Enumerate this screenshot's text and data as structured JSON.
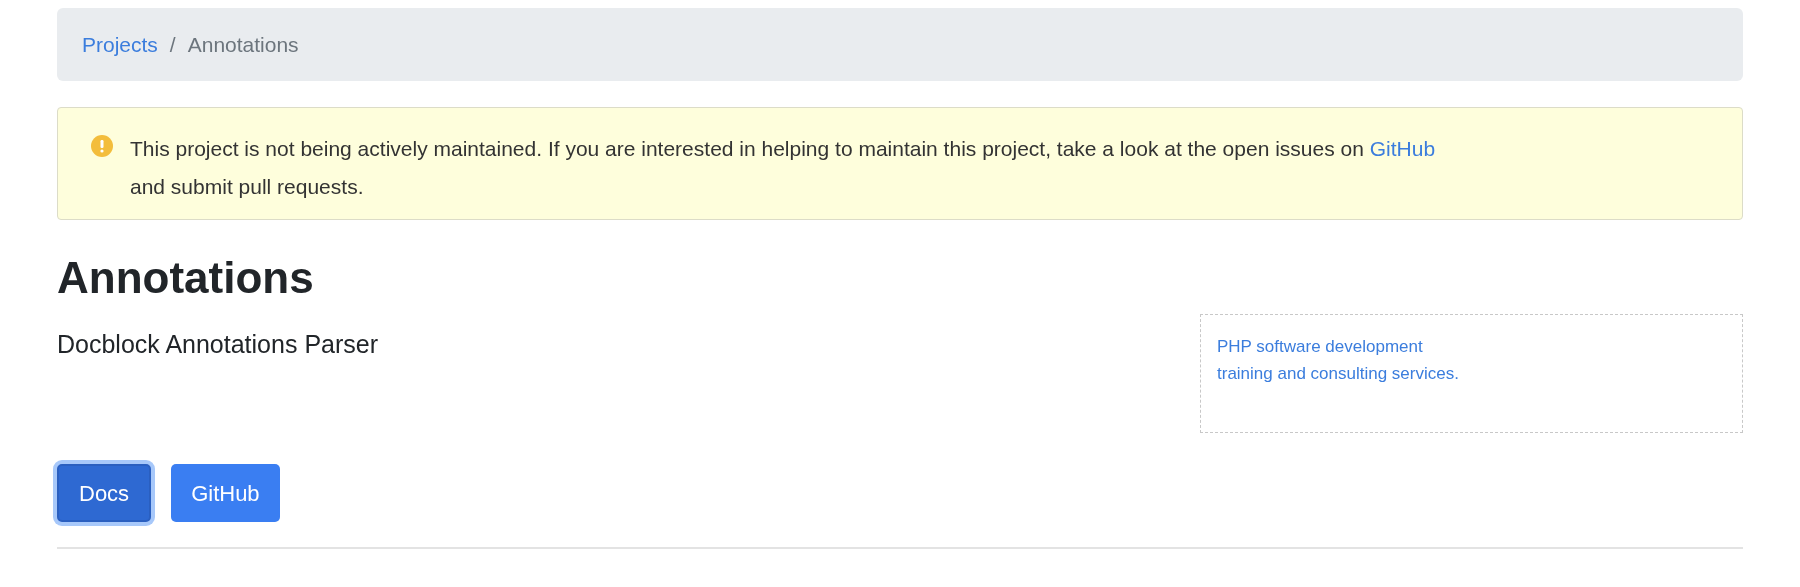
{
  "breadcrumb_separator": "/",
  "breadcrumb": [
    {
      "label": "Projects",
      "kind": "link"
    },
    {
      "label": "Annotations",
      "kind": "current"
    }
  ],
  "alert": {
    "text": "This project is not being actively maintained. If you are interested in helping to maintain this project, take a look at the open issues on ",
    "link": "GitHub",
    "text_after": "and submit pull requests."
  },
  "title": "Annotations",
  "subtitle": "Docblock Annotations Parser",
  "ad": {
    "lines": [
      "PHP software development",
      "training and consulting services."
    ]
  },
  "buttons": [
    {
      "label": "Docs",
      "focused": true
    },
    {
      "label": "GitHub",
      "focused": false
    }
  ]
}
